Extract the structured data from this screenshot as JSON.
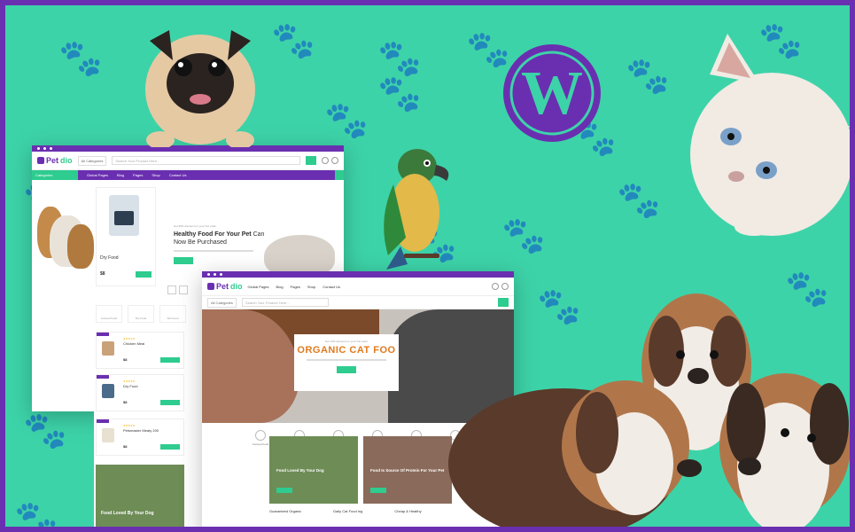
{
  "colors": {
    "background": "#3dd3a8",
    "accent_purple": "#6a2fb0",
    "accent_green": "#2ecc8f",
    "paw": "#6ae6c2"
  },
  "brand": {
    "logo_pet": "Pet",
    "logo_dio": "dio"
  },
  "back_site": {
    "header": {
      "category_select": "All Categories",
      "search_placeholder": "Search Your Product Here...",
      "search_text": "Search"
    },
    "nav": {
      "categories_label": "Categories",
      "items": [
        "Global Pages",
        "Blog",
        "Pages",
        "Shop",
        "Contact Us"
      ]
    },
    "hero": {
      "kicker": "Get 50% discount on your first order",
      "title_bold": "Healthy Food For Your Pet",
      "title_rest": "Can Now Be Purchased",
      "button": "Shop Now"
    },
    "product": {
      "name": "Dry Food",
      "price": "$8",
      "button": "Add to cart"
    },
    "features": [
      "Canned Food",
      "Dry Food",
      "Wet Food"
    ],
    "list": [
      {
        "badge": "Featured",
        "name": "Chicken Meal",
        "price": "$8",
        "button": "Add to cart"
      },
      {
        "badge": "Featured",
        "name": "Dry Food",
        "price": "$8",
        "button": "Add to cart"
      },
      {
        "badge": "Featured",
        "name": "Petsmaster Meaty 200",
        "price": "$8",
        "button": "Add to cart"
      }
    ],
    "promos": [
      {
        "text_a": "Food Loved By",
        "text_b": "Your Dog"
      }
    ]
  },
  "front_site": {
    "header": {
      "category_select": "All Categories",
      "search_placeholder": "Search Your Product Here...",
      "menu": [
        "Global Pages",
        "Blog",
        "Pages",
        "Shop",
        "Contact Us"
      ]
    },
    "hero": {
      "kicker": "Get 10% discount on your first order",
      "title": "ORGANIC CAT FOO",
      "button": "Shop Now"
    },
    "features": [
      "Canned Food",
      "Dry Food",
      "Banner Roster",
      "Brush",
      "Treats",
      "Wet Food"
    ],
    "promos": [
      {
        "text_a": "Food Loved By",
        "text_b": "Your Dog",
        "button": "Shop Now"
      },
      {
        "text_a": "Food Is Source Of Protein For Your Pet",
        "text_b": "",
        "button": "Shop Now"
      }
    ],
    "info": [
      "Guaranteed Organic",
      "Daily Cat Food Ing",
      "Cheap & Healthy"
    ]
  },
  "icons": [
    "wordpress-icon",
    "paw-icon",
    "search-icon",
    "heart-icon",
    "cart-icon"
  ]
}
